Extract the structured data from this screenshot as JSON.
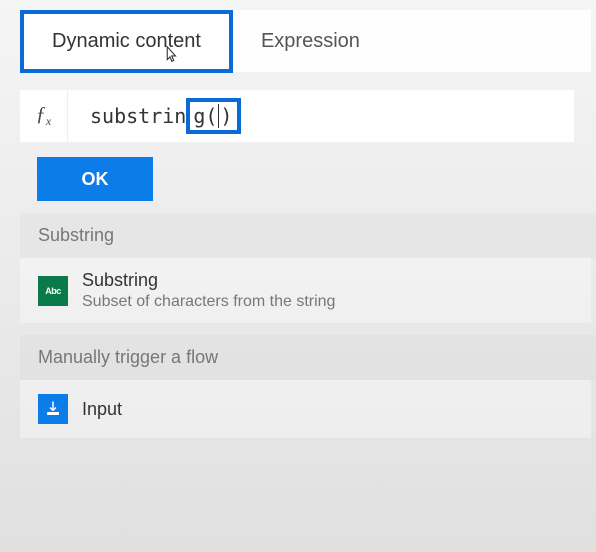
{
  "tabs": {
    "dynamic": "Dynamic content",
    "expression": "Expression"
  },
  "formula": {
    "fx": "fx",
    "prefix": "substrin",
    "highlighted_open": "g(",
    "highlighted_close": ")"
  },
  "buttons": {
    "ok": "OK"
  },
  "sections": {
    "substring": {
      "header": "Substring",
      "item_title": "Substring",
      "item_desc": "Subset of characters from the string",
      "icon_label": "Abc"
    },
    "trigger": {
      "header": "Manually trigger a flow",
      "item_title": "Input"
    }
  }
}
